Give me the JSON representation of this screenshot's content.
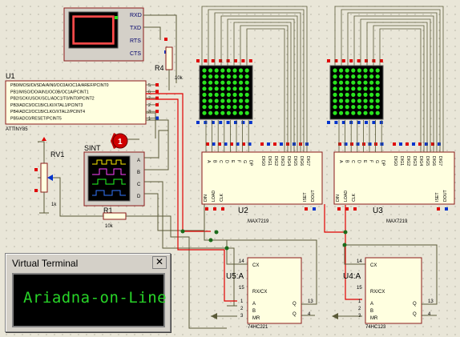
{
  "colors": {
    "wire_red": "#e00000",
    "wire_dark": "#5a5a38",
    "chip_fill": "#ffffe0",
    "chip_border": "#8b1a1a",
    "matrix_on": "#29e41f",
    "terminal_text": "#28d428"
  },
  "serial_monitor": {
    "pins": [
      "RXD",
      "TXD",
      "RTS",
      "CTS"
    ]
  },
  "resistors": {
    "r4": "R4",
    "r4_value": "10k",
    "r1": "R1",
    "r1_value": "10k",
    "rv1": "RV1",
    "rv1_value": "1k"
  },
  "u1": {
    "ref": "U1",
    "part": "ATTINY85",
    "pins": [
      "PB0/MOSI/DI/SDA/AIN0/OC0A/OC1A/AREF/PCINT0",
      "PB1/MISO/DO/AIN1/OC0B/OC1A/PCINT1",
      "PB2/SCK/USCK/SCL/ADC1/T0/INT0/PCINT2",
      "PB3/ADC3/OC1B/CLKI/XTAL1/PCINT3",
      "PB4/ADC2/OC1B/CLKO/XTAL2/PCINT4",
      "PB5/ADC0/RESET/PCINT5"
    ],
    "pin_nums": [
      "5",
      "6",
      "7",
      "2",
      "3",
      "1"
    ]
  },
  "probe": {
    "label": "1"
  },
  "sint": {
    "label": "SINT",
    "channels": [
      "A",
      "B",
      "C",
      "D"
    ]
  },
  "max_u2": {
    "ref": "U2",
    "part": "MAX7219"
  },
  "max_u3": {
    "ref": "U3",
    "part": "MAX7219"
  },
  "max_pins": {
    "left": [
      "A",
      "B",
      "C",
      "D",
      "E",
      "F",
      "G",
      "DP"
    ],
    "digits": [
      "DIG0",
      "DIG1",
      "DIG2",
      "DIG3",
      "DIG4",
      "DIG5",
      "DIG6",
      "DIG7"
    ],
    "bottom": [
      "DIN",
      "LOAD",
      "CLK"
    ],
    "right": [
      "ISET",
      "DOUT"
    ]
  },
  "u5a": {
    "ref": "U5:A",
    "part": "74HC221",
    "pins": [
      "CX",
      "RX/CX",
      "A",
      "B",
      "MR",
      "Q",
      "Q"
    ],
    "pin_nums": [
      "14",
      "15",
      "1",
      "2",
      "3",
      "13",
      "4"
    ]
  },
  "u4a": {
    "ref": "U4:A",
    "part": "74HC123",
    "pins": [
      "CX",
      "RX/CX",
      "A",
      "B",
      "MR",
      "Q",
      "Q"
    ],
    "pin_nums": [
      "14",
      "15",
      "1",
      "2",
      "3",
      "13",
      "4"
    ]
  },
  "terminal": {
    "title": "Virtual Terminal",
    "close": "✕",
    "text": "Ariadna-on-Line"
  }
}
